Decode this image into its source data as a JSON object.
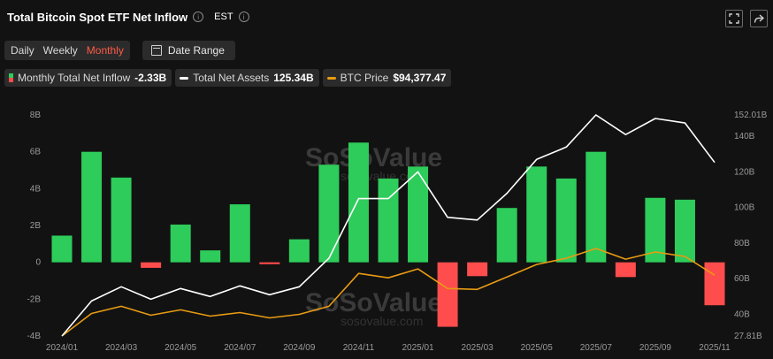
{
  "header": {
    "title": "Total Bitcoin Spot ETF Net Inflow",
    "timezone": "EST"
  },
  "controls": {
    "tabs": [
      {
        "label": "Daily",
        "active": false
      },
      {
        "label": "Weekly",
        "active": false
      },
      {
        "label": "Monthly",
        "active": true
      }
    ],
    "date_range_label": "Date Range"
  },
  "legend": [
    {
      "label": "Monthly Total Net Inflow",
      "value": "-2.33B",
      "color": "bars"
    },
    {
      "label": "Total Net Assets",
      "value": "125.34B",
      "color": "#ffffff"
    },
    {
      "label": "BTC Price",
      "value": "$94,377.47",
      "color": "#e89b12"
    }
  ],
  "watermark": {
    "brand": "SoSoValue",
    "url": "sosovalue.com"
  },
  "colors": {
    "positive": "#2ecc5b",
    "negative": "#ff4d4d",
    "assets_line": "#ffffff",
    "btc_line": "#e89b12",
    "background": "#121212"
  },
  "chart_data": {
    "type": "bar",
    "categories": [
      "2024/01",
      "2024/02",
      "2024/03",
      "2024/04",
      "2024/05",
      "2024/06",
      "2024/07",
      "2024/08",
      "2024/09",
      "2024/10",
      "2024/11",
      "2024/12",
      "2025/01",
      "2025/02",
      "2025/03",
      "2025/04",
      "2025/05",
      "2025/06",
      "2025/07",
      "2025/08",
      "2025/09",
      "2025/10",
      "2025/11"
    ],
    "x_tick_labels": [
      "2024/01",
      "2024/03",
      "2024/05",
      "2024/07",
      "2024/09",
      "2024/11",
      "2025/01",
      "2025/03",
      "2025/05",
      "2025/07",
      "2025/09",
      "2025/11"
    ],
    "series": [
      {
        "name": "Monthly Total Net Inflow",
        "axis": "left",
        "values": [
          1.45,
          6.0,
          4.6,
          -0.3,
          2.05,
          0.65,
          3.15,
          -0.1,
          1.25,
          5.3,
          6.5,
          4.55,
          5.2,
          -3.5,
          -0.75,
          2.95,
          5.2,
          4.55,
          6.0,
          -0.8,
          3.5,
          3.4,
          -2.33
        ]
      },
      {
        "name": "Total Net Assets",
        "axis": "right",
        "values": [
          27.81,
          47.5,
          55.5,
          48.5,
          54.5,
          50.0,
          56.0,
          51.0,
          55.5,
          71.5,
          105.0,
          105.0,
          120.0,
          94.5,
          93.0,
          108.0,
          127.0,
          134.0,
          152.01,
          141.0,
          150.0,
          147.5,
          125.34
        ]
      },
      {
        "name": "BTC Price",
        "axis": "right",
        "values": [
          27.81,
          40.5,
          44.5,
          39.5,
          42.5,
          39.0,
          41.0,
          38.0,
          40.0,
          44.5,
          63.0,
          60.5,
          65.5,
          54.5,
          54.0,
          61.0,
          68.0,
          71.5,
          77.0,
          71.0,
          75.0,
          72.5,
          62.0
        ]
      }
    ],
    "left_axis": {
      "ticks": [
        "8B",
        "6B",
        "4B",
        "2B",
        "0",
        "-2B",
        "-4B"
      ],
      "tick_values": [
        8,
        6,
        4,
        2,
        0,
        -2,
        -4
      ],
      "ylim": [
        -4,
        8
      ]
    },
    "right_axis": {
      "ticks": [
        "152.01B",
        "140B",
        "120B",
        "100B",
        "80B",
        "60B",
        "40B",
        "27.81B"
      ],
      "tick_values": [
        152.01,
        140,
        120,
        100,
        80,
        60,
        40,
        27.81
      ],
      "ylim": [
        27.81,
        152.01
      ]
    },
    "grid": false
  }
}
